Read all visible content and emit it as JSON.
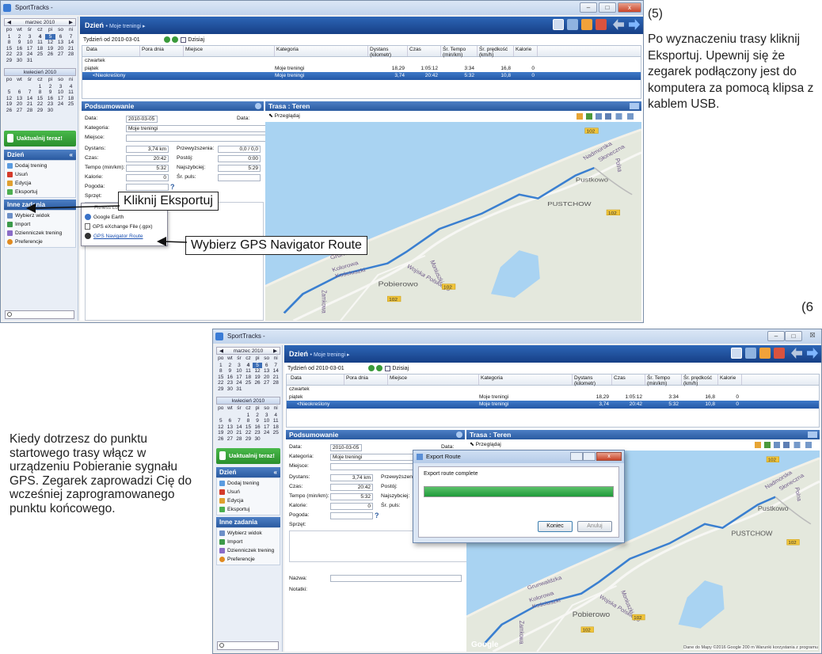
{
  "app": {
    "title": "SportTracks -",
    "window_min": "–",
    "window_max": "□",
    "window_close": "x",
    "window_close2": "☒"
  },
  "calendar": {
    "month1": "marzec 2010",
    "month2": "kwiecień 2010",
    "prev": "◀",
    "next": "▶",
    "days": [
      "po",
      "wt",
      "śr",
      "cz",
      "pi",
      "so",
      "ni"
    ],
    "march": [
      "1",
      "2",
      "3",
      "4",
      "5",
      "6",
      "7",
      "8",
      "9",
      "10",
      "11",
      "12",
      "13",
      "14",
      "15",
      "16",
      "17",
      "18",
      "19",
      "20",
      "21",
      "22",
      "23",
      "24",
      "25",
      "26",
      "27",
      "28",
      "29",
      "30",
      "31"
    ],
    "selected_day": "5",
    "april": [
      "",
      "",
      "",
      "1",
      "2",
      "3",
      "4",
      "5",
      "6",
      "7",
      "8",
      "9",
      "10",
      "11",
      "12",
      "13",
      "14",
      "15",
      "16",
      "17",
      "18",
      "19",
      "20",
      "21",
      "22",
      "23",
      "24",
      "25",
      "26",
      "27",
      "28",
      "29",
      "30"
    ]
  },
  "sidebar": {
    "update_label": "Uaktualnij teraz!",
    "day_title": "Dzień",
    "day_items": [
      "Dodaj trening",
      "Usuń",
      "Edycja",
      "Eksportuj"
    ],
    "tasks_title": "Inne zadania",
    "task_items": [
      "Wybierz widok",
      "Import",
      "Dzienniczek trening",
      "Preferencje"
    ],
    "collapse": "«"
  },
  "header": {
    "title": "Dzień",
    "crumb": "Moje treningi",
    "week_label": "Tydzień od 2010-03-01",
    "today_label": "Dzisiaj"
  },
  "table": {
    "columns": [
      "Data",
      "Pora dnia",
      "Miejsce",
      "Kategoria",
      "Dystans (kilometr)",
      "Czas",
      "Śr. Tempo (min/km)",
      "Śr. prędkość (km/h)",
      "Kalorie"
    ],
    "rows": [
      {
        "date": "czwartek",
        "category": "",
        "distance": "",
        "time": "",
        "pace": "",
        "speed": "",
        "cal": ""
      },
      {
        "date": "piątek",
        "category": "Moje treningi",
        "distance": "18,29",
        "time": "1:05:12",
        "pace": "3:34",
        "speed": "16,8",
        "cal": "0"
      },
      {
        "date": "<Nieokreślony Cza...",
        "category": "Moje treningi",
        "distance": "3,74",
        "time": "20:42",
        "pace": "5:32",
        "speed": "10,8",
        "cal": "0"
      }
    ]
  },
  "summary": {
    "title": "Podsumowanie",
    "labels": [
      "Data:",
      "Kategoria:",
      "Miejsce:",
      "Dystans:",
      "Czas:",
      "Tempo (min/km):",
      "Kalorie:",
      "Pogoda:",
      "Sprzęt:"
    ],
    "right_labels": [
      "Przewyższenia:",
      "Postój:",
      "Najszybciej:",
      "Śr. puls:"
    ],
    "values": {
      "date": "2010-03-05",
      "category": "Moje treningi",
      "distance": "3,74 km",
      "time": "20:42",
      "pace": "5:32",
      "calories": "0",
      "elevation": "0,0 / 0,0",
      "stop": "0:00",
      "fastest": "5:29"
    },
    "data_btn": "Data:",
    "name_label": "Nazwa:",
    "notes_label": "Notatki:"
  },
  "route": {
    "title": "Trasa : Teren",
    "view_label": "Przeglądaj",
    "places": [
      "PUSTCHOW",
      "Pustkowo",
      "Pobierowo",
      "Nadmorska",
      "Słoneczna",
      "Polna",
      "Grunwaldzka",
      "Kolorowa",
      "Kościuszki",
      "Zamkowa",
      "Wojska Polskiego",
      "Moniuszki",
      "Rolna"
    ],
    "road": "102",
    "map_footer": "Dane do Mapy ©2016 Google   200 m   Warunki korzystania z programu",
    "google": "Google"
  },
  "export_menu": {
    "items": [
      "Fitness Log",
      "Google Earth",
      "GPS eXchange File (.gpx)",
      "GPS Navigator Route"
    ]
  },
  "callouts": {
    "export": "Kliknij Eksportuj",
    "gps": "Wybierz GPS Navigator Route"
  },
  "notes": {
    "step5": "(5)",
    "step5_text": "Po wyznaczeniu trasy kliknij Eksportuj. Upewnij się że zegarek podłączony jest do komputera za pomocą klipsa z kablem USB.",
    "step6": "(6",
    "step6_text": "Kiedy dotrzesz do punktu startowego trasy włącz w urządzeniu Pobieranie sygnału GPS. Zegarek zaprowadzi Cię do wcześniej zaprogramowanego punktu końcowego."
  },
  "dialog": {
    "title": "Export Route",
    "message": "Export route complete",
    "progress": 1.0,
    "finish": "Koniec",
    "cancel": "Anuluj"
  },
  "colors": {
    "accent": "#2a5aa0",
    "route": "#3a7fd0",
    "progress": "#1f9a3a"
  }
}
